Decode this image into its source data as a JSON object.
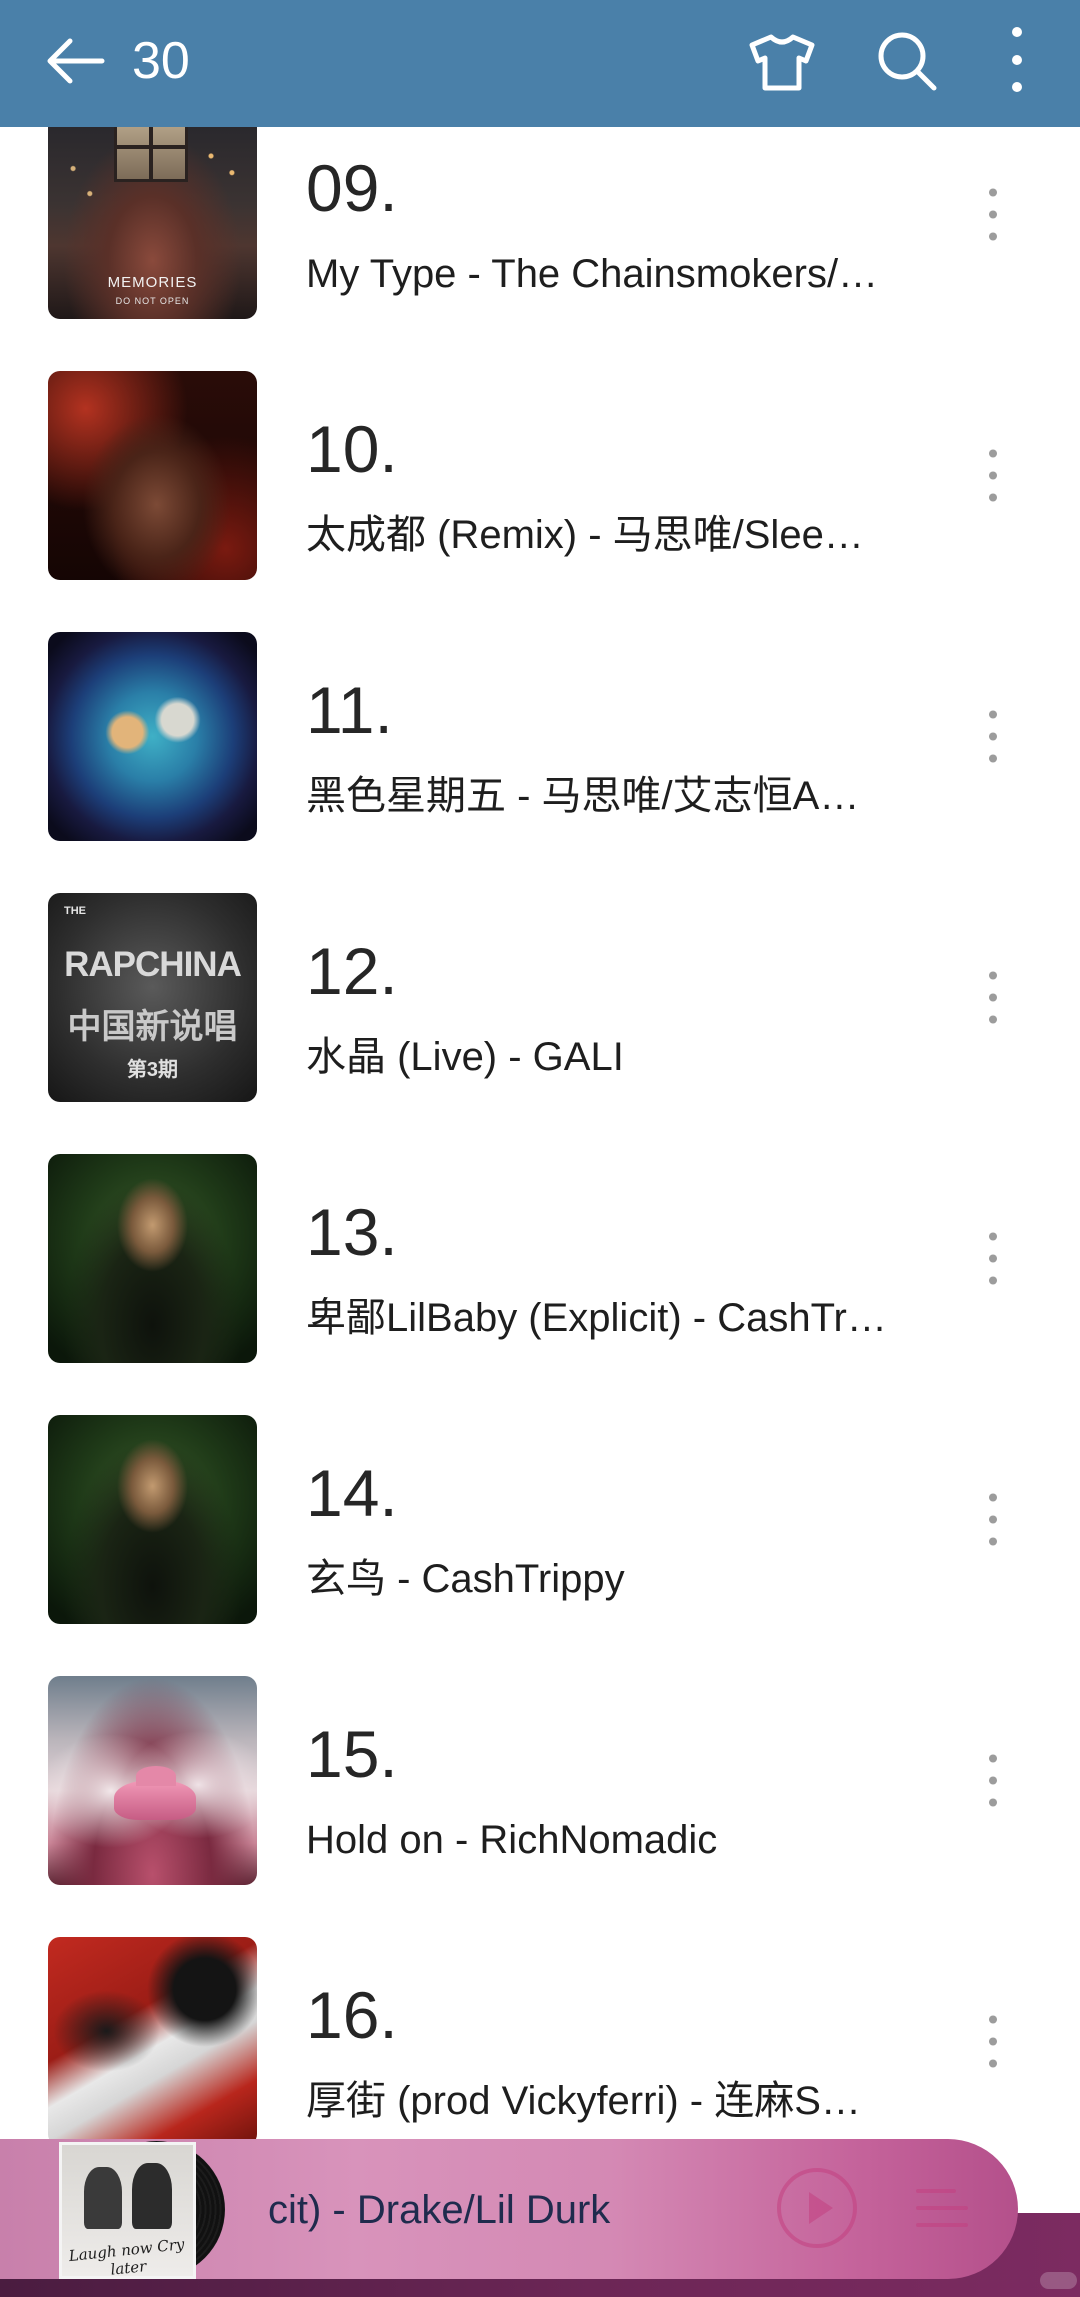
{
  "header": {
    "back_icon": "arrow-left-icon",
    "title": "30",
    "actions": [
      "tshirt-icon",
      "search-icon",
      "more-vertical-icon"
    ],
    "background_color": "#4a80a9"
  },
  "songs": [
    {
      "number": "09.",
      "subtitle": "My Type - The Chainsmokers/…",
      "art_text": [
        "MEMORIES",
        "DO NOT OPEN"
      ]
    },
    {
      "number": "10.",
      "subtitle": "太成都 (Remix) - 马思唯/Slee…"
    },
    {
      "number": "11.",
      "subtitle": "黑色星期五 - 马思唯/艾志恒A…"
    },
    {
      "number": "12.",
      "subtitle": "水晶 (Live) - GALI",
      "art_text": [
        "THE",
        "RAPCHINA",
        "中国新说唱",
        "第3期"
      ]
    },
    {
      "number": "13.",
      "subtitle": "卑鄙LilBaby (Explicit) - CashTr…"
    },
    {
      "number": "14.",
      "subtitle": "玄鸟 - CashTrippy"
    },
    {
      "number": "15.",
      "subtitle": "Hold on - RichNomadic"
    },
    {
      "number": "16.",
      "subtitle": "厚街 (prod Vickyferri) - 连麻S…"
    }
  ],
  "row_menu_icon": "more-vertical-icon",
  "player": {
    "now_playing": "cit) - Drake/Lil Durk",
    "album_art_text": "Laugh now Cry later",
    "play_icon": "play-icon",
    "playlist_icon": "playlist-icon",
    "accent_color": "#c2407f"
  }
}
